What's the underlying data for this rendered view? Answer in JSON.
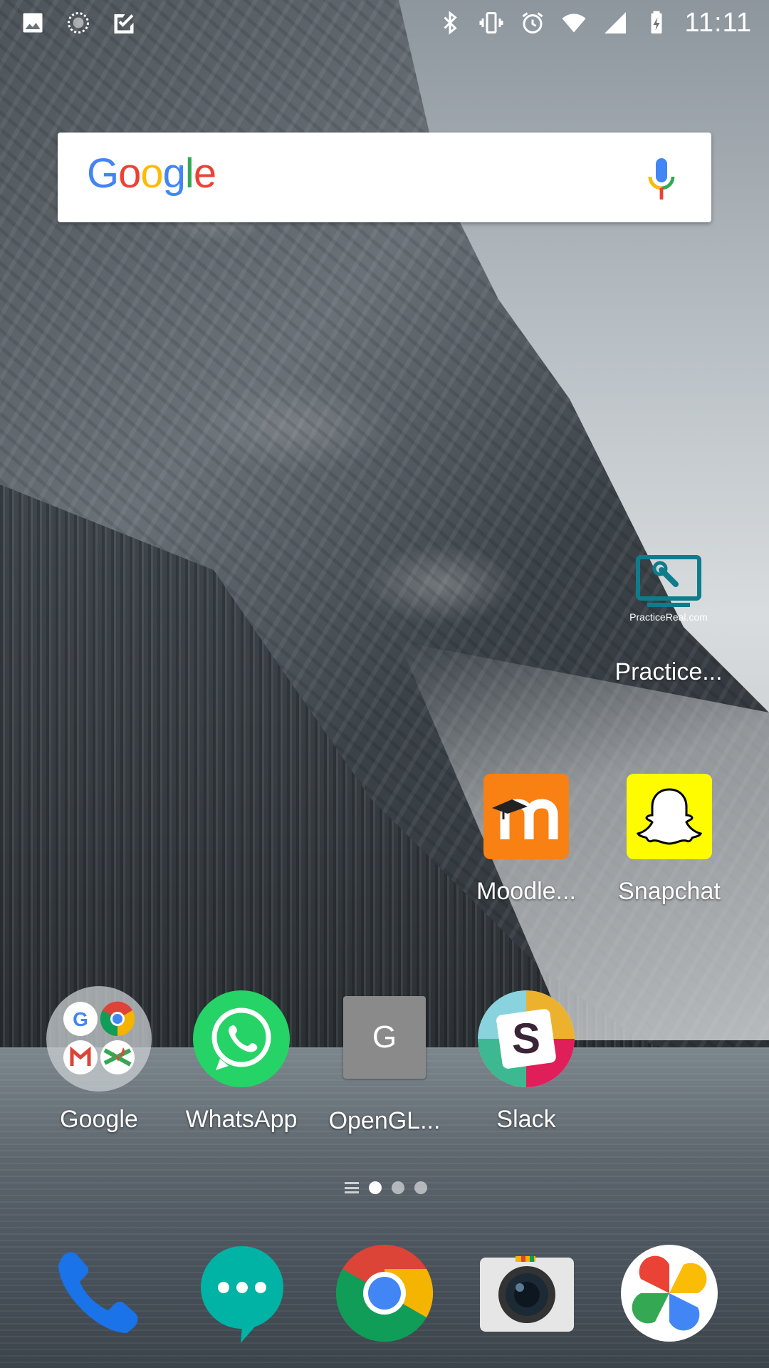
{
  "status_bar": {
    "time": "11:11",
    "left_icons": [
      "image-notification-icon",
      "loading-notification-icon",
      "checklist-notification-icon"
    ],
    "right_icons": [
      "bluetooth-icon",
      "vibrate-icon",
      "alarm-icon",
      "wifi-icon",
      "cell-signal-icon",
      "battery-charging-icon"
    ]
  },
  "search": {
    "logo_letters": [
      "G",
      "o",
      "o",
      "g",
      "l",
      "e"
    ],
    "logo_colors": [
      "#4285F4",
      "#EA4335",
      "#FBBC05",
      "#4285F4",
      "#34A853",
      "#EA4335"
    ],
    "mic_icon": "mic-icon"
  },
  "widgets": {
    "practicereal_caption": "PracticeReal.com"
  },
  "apps": {
    "practice": {
      "label": "Practice...",
      "icon": "practicereal-icon"
    },
    "moodle": {
      "label": "Moodle...",
      "icon": "moodle-icon"
    },
    "snapchat": {
      "label": "Snapchat",
      "icon": "snapchat-icon"
    },
    "google_folder": {
      "label": "Google",
      "icon": "google-folder-icon"
    },
    "whatsapp": {
      "label": "WhatsApp",
      "icon": "whatsapp-icon"
    },
    "opengl": {
      "label": "OpenGL...",
      "icon": "opengl-icon",
      "letter": "G"
    },
    "slack": {
      "label": "Slack",
      "icon": "slack-icon",
      "letter": "S"
    }
  },
  "dock": [
    {
      "name": "phone",
      "icon": "phone-icon"
    },
    {
      "name": "messages",
      "icon": "messages-icon"
    },
    {
      "name": "chrome",
      "icon": "chrome-icon"
    },
    {
      "name": "camera",
      "icon": "camera-icon"
    },
    {
      "name": "photos",
      "icon": "photos-icon"
    }
  ],
  "page_indicator": {
    "pages": 3,
    "active_page": 1
  },
  "colors": {
    "whatsapp": "#25D366",
    "snapchat": "#FFFC00",
    "moodle": "#F98012",
    "practicereal": "#0F7C8C",
    "phone": "#1A73E8",
    "messages": "#00B3A4"
  }
}
